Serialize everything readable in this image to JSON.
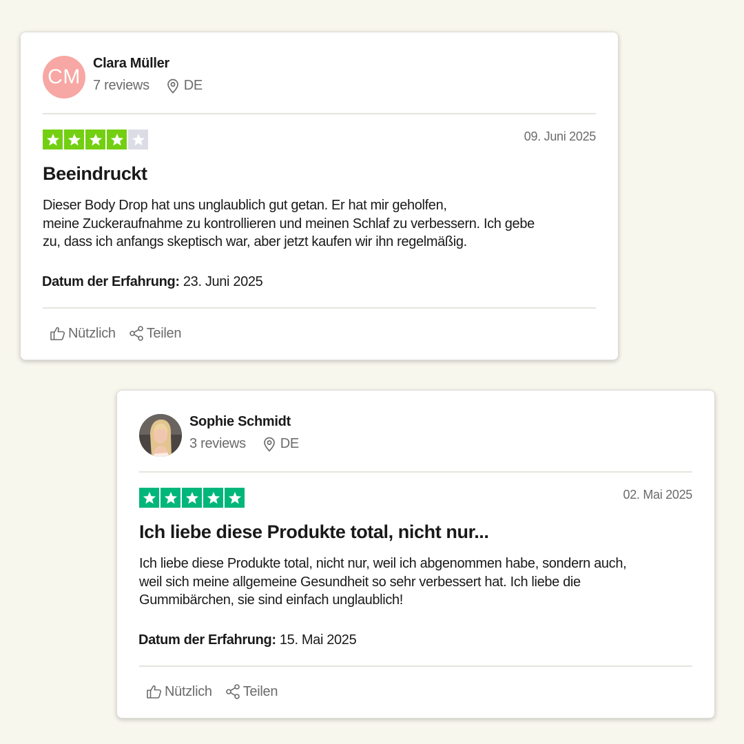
{
  "colors": {
    "page_background": "#f8f7ee",
    "star_green_4": "#73cf11",
    "star_green_5": "#00b67a",
    "star_empty": "#dcdce6",
    "muted_text": "#6b6b6b",
    "avatar_initials_bg": "#f7a7a4"
  },
  "reviews": [
    {
      "reviewer": {
        "initials": "CM",
        "name": "Clara Müller",
        "review_count": "7 reviews",
        "country": "DE",
        "location_icon": "location-pin-icon"
      },
      "rating": 4,
      "rating_max": 5,
      "date": "09. Juni 2025",
      "title": "Beeindruckt",
      "body": "Dieser Body Drop hat uns unglaublich gut getan. Er hat mir geholfen,\nmeine Zuckeraufnahme zu kontrollieren und meinen Schlaf zu verbessern. Ich gebe\n zu, dass ich anfangs skeptisch war, aber jetzt kaufen wir ihn regelmäßig.",
      "experience_label": "Datum der Erfahrung:",
      "experience_date": "23. Juni 2025",
      "actions": {
        "useful_label": "Nützlich",
        "useful_icon": "thumbs-up-icon",
        "share_label": "Teilen",
        "share_icon": "share-icon"
      }
    },
    {
      "reviewer": {
        "avatar": "profile-photo",
        "name": "Sophie Schmidt",
        "review_count": "3 reviews",
        "country": "DE",
        "location_icon": "location-pin-icon"
      },
      "rating": 5,
      "rating_max": 5,
      "date": "02. Mai 2025",
      "title": "Ich liebe diese Produkte total, nicht nur...",
      "body": "Ich liebe diese Produkte total, nicht nur, weil ich abgenommen habe, sondern auch,\nweil sich meine allgemeine Gesundheit so sehr verbessert hat. Ich liebe die\nGummibärchen, sie sind einfach unglaublich!",
      "experience_label": "Datum der Erfahrung:",
      "experience_date": "15. Mai 2025",
      "actions": {
        "useful_label": "Nützlich",
        "useful_icon": "thumbs-up-icon",
        "share_label": "Teilen",
        "share_icon": "share-icon"
      }
    }
  ]
}
